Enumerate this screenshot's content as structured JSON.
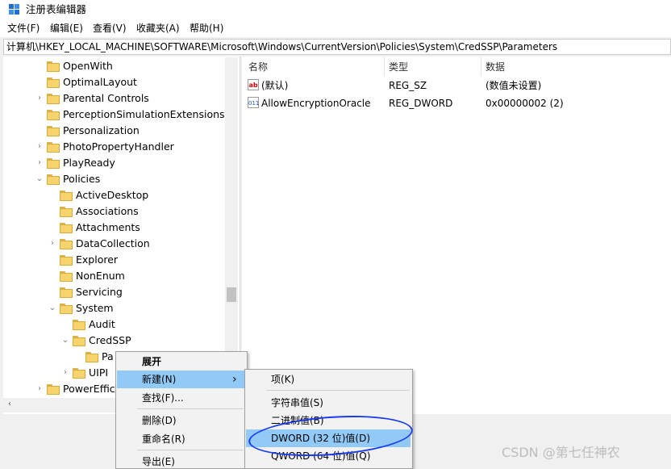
{
  "window": {
    "title": "注册表编辑器",
    "icon": "registry-editor-icon"
  },
  "menubar": [
    "文件(F)",
    "编辑(E)",
    "查看(V)",
    "收藏夹(A)",
    "帮助(H)"
  ],
  "address": "计算机\\HKEY_LOCAL_MACHINE\\SOFTWARE\\Microsoft\\Windows\\CurrentVersion\\Policies\\System\\CredSSP\\Parameters",
  "tree": [
    {
      "label": "OpenWith",
      "arrow": ""
    },
    {
      "label": "OptimalLayout",
      "arrow": ""
    },
    {
      "label": "Parental Controls",
      "arrow": "›"
    },
    {
      "label": "PerceptionSimulationExtensions",
      "arrow": ""
    },
    {
      "label": "Personalization",
      "arrow": ""
    },
    {
      "label": "PhotoPropertyHandler",
      "arrow": "›"
    },
    {
      "label": "PlayReady",
      "arrow": "›"
    },
    {
      "label": "Policies",
      "arrow": "⌄"
    },
    {
      "label": "ActiveDesktop",
      "arrow": ""
    },
    {
      "label": "Associations",
      "arrow": ""
    },
    {
      "label": "Attachments",
      "arrow": ""
    },
    {
      "label": "DataCollection",
      "arrow": "›"
    },
    {
      "label": "Explorer",
      "arrow": ""
    },
    {
      "label": "NonEnum",
      "arrow": ""
    },
    {
      "label": "Servicing",
      "arrow": ""
    },
    {
      "label": "System",
      "arrow": "⌄"
    },
    {
      "label": "Audit",
      "arrow": ""
    },
    {
      "label": "CredSSP",
      "arrow": "⌄"
    },
    {
      "label": "Pa",
      "arrow": ""
    },
    {
      "label": "UIPI",
      "arrow": "›"
    },
    {
      "label": "PowerEffici",
      "arrow": "›"
    }
  ],
  "columns": {
    "name": "名称",
    "type": "类型",
    "data": "数据"
  },
  "values": [
    {
      "icon": "ab",
      "name": "(默认)",
      "type": "REG_SZ",
      "data": "(数值未设置)"
    },
    {
      "icon": "011",
      "name": "AllowEncryptionOracle",
      "type": "REG_DWORD",
      "data": "0x00000002 (2)"
    }
  ],
  "context_menu": {
    "expand": "展开",
    "new": "新建(N)",
    "new_arrow": "›",
    "find": "查找(F)...",
    "delete": "删除(D)",
    "rename": "重命名(R)",
    "export": "导出(E)"
  },
  "submenu": {
    "key": "项(K)",
    "string": "字符串值(S)",
    "binary": "二进制值(B)",
    "dword": "DWORD (32 位)值(D)",
    "qword": "QWORD (64 位)值(Q)"
  },
  "scroll_left_arrow": "‹",
  "watermark": "CSDN @第七任神农"
}
